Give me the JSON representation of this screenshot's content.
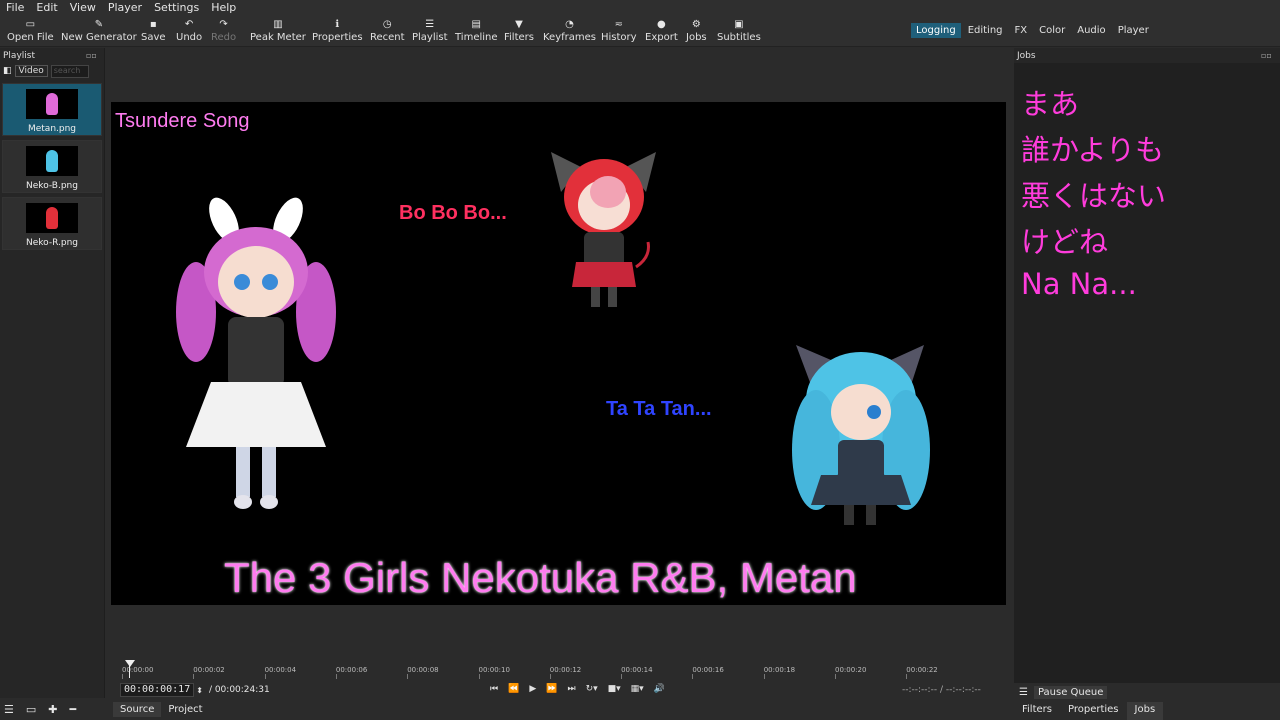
{
  "menu": [
    "File",
    "Edit",
    "View",
    "Player",
    "Settings",
    "Help"
  ],
  "toolbar": [
    {
      "label": "Open File",
      "icon": "folder-icon",
      "glyph": "▭",
      "enabled": true
    },
    {
      "label": "New Generator",
      "icon": "generator-icon",
      "glyph": "✎",
      "enabled": true
    },
    {
      "label": "Save",
      "icon": "save-icon",
      "glyph": "▪",
      "enabled": true
    },
    {
      "label": "Undo",
      "icon": "undo-icon",
      "glyph": "↶",
      "enabled": true
    },
    {
      "label": "Redo",
      "icon": "redo-icon",
      "glyph": "↷",
      "enabled": false
    },
    {
      "label": "Peak Meter",
      "icon": "peak-meter-icon",
      "glyph": "▥",
      "enabled": true
    },
    {
      "label": "Properties",
      "icon": "info-icon",
      "glyph": "ℹ",
      "enabled": true
    },
    {
      "label": "Recent",
      "icon": "clock-icon",
      "glyph": "◷",
      "enabled": true
    },
    {
      "label": "Playlist",
      "icon": "list-icon",
      "glyph": "☰",
      "enabled": true
    },
    {
      "label": "Timeline",
      "icon": "timeline-icon",
      "glyph": "▤",
      "enabled": true
    },
    {
      "label": "Filters",
      "icon": "filter-icon",
      "glyph": "▼",
      "enabled": true
    },
    {
      "label": "Keyframes",
      "icon": "stopwatch-icon",
      "glyph": "◔",
      "enabled": true
    },
    {
      "label": "History",
      "icon": "history-icon",
      "glyph": "≂",
      "enabled": true
    },
    {
      "label": "Export",
      "icon": "export-icon",
      "glyph": "●",
      "enabled": true
    },
    {
      "label": "Jobs",
      "icon": "gear-icon",
      "glyph": "⚙",
      "enabled": true
    },
    {
      "label": "Subtitles",
      "icon": "subtitles-icon",
      "glyph": "▣",
      "enabled": true
    }
  ],
  "layouts": [
    "Logging",
    "Editing",
    "FX",
    "Color",
    "Audio",
    "Player"
  ],
  "layouts_active": "Logging",
  "playlist": {
    "title": "Playlist",
    "filter_label": "Video",
    "search_placeholder": "search",
    "items": [
      {
        "name": "Metan.png",
        "color": "#e06ad8",
        "selected": true
      },
      {
        "name": "Neko-B.png",
        "color": "#4ec3e6",
        "selected": false
      },
      {
        "name": "Neko-R.png",
        "color": "#e2303a",
        "selected": false
      }
    ]
  },
  "viewer": {
    "song_title": "Tsundere Song",
    "red_text": "Bo Bo Bo...",
    "blue_text": "Ta Ta Tan...",
    "main_title": "The 3 Girls Nekotuka R&B, Metan"
  },
  "jobs": {
    "title": "Jobs",
    "lines": [
      "まあ",
      "誰かよりも",
      "悪くはない",
      "けどね",
      "Na Na..."
    ],
    "pause_queue": "Pause Queue",
    "bottom_tabs": [
      "Filters",
      "Properties",
      "Jobs"
    ],
    "active_tab": "Jobs"
  },
  "timeline": {
    "ticks": [
      "00:00:00",
      "00:00:02",
      "00:00:04",
      "00:00:06",
      "00:00:08",
      "00:00:10",
      "00:00:12",
      "00:00:14",
      "00:00:16",
      "00:00:18",
      "00:00:20",
      "00:00:22"
    ],
    "current_tc": "00:00:00:17",
    "total_tc": "/  00:00:24:31",
    "in_out": "--:--:--:-- / --:--:--:--",
    "source_tabs": [
      "Source",
      "Project"
    ],
    "active_source": "Source"
  },
  "colors": {
    "accent": "#1f5f7a",
    "lyric_pink": "#ff3cdc",
    "title_pink": "#ff7cf0",
    "red_text": "#ff3060",
    "blue_text": "#2f44ff"
  }
}
